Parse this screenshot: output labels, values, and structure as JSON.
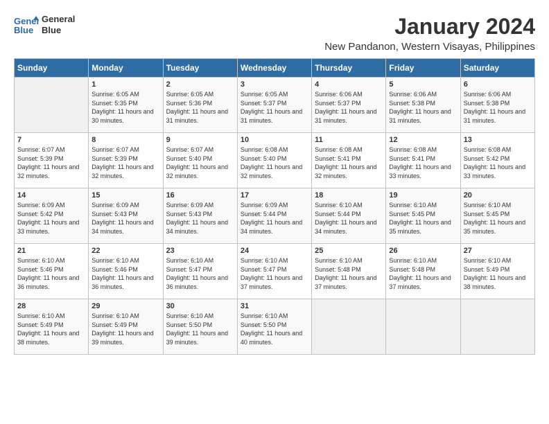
{
  "header": {
    "logo_line1": "General",
    "logo_line2": "Blue",
    "title": "January 2024",
    "subtitle": "New Pandanon, Western Visayas, Philippines"
  },
  "weekdays": [
    "Sunday",
    "Monday",
    "Tuesday",
    "Wednesday",
    "Thursday",
    "Friday",
    "Saturday"
  ],
  "weeks": [
    [
      {
        "day": "",
        "sunrise": "",
        "sunset": "",
        "daylight": ""
      },
      {
        "day": "1",
        "sunrise": "Sunrise: 6:05 AM",
        "sunset": "Sunset: 5:35 PM",
        "daylight": "Daylight: 11 hours and 30 minutes."
      },
      {
        "day": "2",
        "sunrise": "Sunrise: 6:05 AM",
        "sunset": "Sunset: 5:36 PM",
        "daylight": "Daylight: 11 hours and 31 minutes."
      },
      {
        "day": "3",
        "sunrise": "Sunrise: 6:05 AM",
        "sunset": "Sunset: 5:37 PM",
        "daylight": "Daylight: 11 hours and 31 minutes."
      },
      {
        "day": "4",
        "sunrise": "Sunrise: 6:06 AM",
        "sunset": "Sunset: 5:37 PM",
        "daylight": "Daylight: 11 hours and 31 minutes."
      },
      {
        "day": "5",
        "sunrise": "Sunrise: 6:06 AM",
        "sunset": "Sunset: 5:38 PM",
        "daylight": "Daylight: 11 hours and 31 minutes."
      },
      {
        "day": "6",
        "sunrise": "Sunrise: 6:06 AM",
        "sunset": "Sunset: 5:38 PM",
        "daylight": "Daylight: 11 hours and 31 minutes."
      }
    ],
    [
      {
        "day": "7",
        "sunrise": "Sunrise: 6:07 AM",
        "sunset": "Sunset: 5:39 PM",
        "daylight": "Daylight: 11 hours and 32 minutes."
      },
      {
        "day": "8",
        "sunrise": "Sunrise: 6:07 AM",
        "sunset": "Sunset: 5:39 PM",
        "daylight": "Daylight: 11 hours and 32 minutes."
      },
      {
        "day": "9",
        "sunrise": "Sunrise: 6:07 AM",
        "sunset": "Sunset: 5:40 PM",
        "daylight": "Daylight: 11 hours and 32 minutes."
      },
      {
        "day": "10",
        "sunrise": "Sunrise: 6:08 AM",
        "sunset": "Sunset: 5:40 PM",
        "daylight": "Daylight: 11 hours and 32 minutes."
      },
      {
        "day": "11",
        "sunrise": "Sunrise: 6:08 AM",
        "sunset": "Sunset: 5:41 PM",
        "daylight": "Daylight: 11 hours and 32 minutes."
      },
      {
        "day": "12",
        "sunrise": "Sunrise: 6:08 AM",
        "sunset": "Sunset: 5:41 PM",
        "daylight": "Daylight: 11 hours and 33 minutes."
      },
      {
        "day": "13",
        "sunrise": "Sunrise: 6:08 AM",
        "sunset": "Sunset: 5:42 PM",
        "daylight": "Daylight: 11 hours and 33 minutes."
      }
    ],
    [
      {
        "day": "14",
        "sunrise": "Sunrise: 6:09 AM",
        "sunset": "Sunset: 5:42 PM",
        "daylight": "Daylight: 11 hours and 33 minutes."
      },
      {
        "day": "15",
        "sunrise": "Sunrise: 6:09 AM",
        "sunset": "Sunset: 5:43 PM",
        "daylight": "Daylight: 11 hours and 34 minutes."
      },
      {
        "day": "16",
        "sunrise": "Sunrise: 6:09 AM",
        "sunset": "Sunset: 5:43 PM",
        "daylight": "Daylight: 11 hours and 34 minutes."
      },
      {
        "day": "17",
        "sunrise": "Sunrise: 6:09 AM",
        "sunset": "Sunset: 5:44 PM",
        "daylight": "Daylight: 11 hours and 34 minutes."
      },
      {
        "day": "18",
        "sunrise": "Sunrise: 6:10 AM",
        "sunset": "Sunset: 5:44 PM",
        "daylight": "Daylight: 11 hours and 34 minutes."
      },
      {
        "day": "19",
        "sunrise": "Sunrise: 6:10 AM",
        "sunset": "Sunset: 5:45 PM",
        "daylight": "Daylight: 11 hours and 35 minutes."
      },
      {
        "day": "20",
        "sunrise": "Sunrise: 6:10 AM",
        "sunset": "Sunset: 5:45 PM",
        "daylight": "Daylight: 11 hours and 35 minutes."
      }
    ],
    [
      {
        "day": "21",
        "sunrise": "Sunrise: 6:10 AM",
        "sunset": "Sunset: 5:46 PM",
        "daylight": "Daylight: 11 hours and 36 minutes."
      },
      {
        "day": "22",
        "sunrise": "Sunrise: 6:10 AM",
        "sunset": "Sunset: 5:46 PM",
        "daylight": "Daylight: 11 hours and 36 minutes."
      },
      {
        "day": "23",
        "sunrise": "Sunrise: 6:10 AM",
        "sunset": "Sunset: 5:47 PM",
        "daylight": "Daylight: 11 hours and 36 minutes."
      },
      {
        "day": "24",
        "sunrise": "Sunrise: 6:10 AM",
        "sunset": "Sunset: 5:47 PM",
        "daylight": "Daylight: 11 hours and 37 minutes."
      },
      {
        "day": "25",
        "sunrise": "Sunrise: 6:10 AM",
        "sunset": "Sunset: 5:48 PM",
        "daylight": "Daylight: 11 hours and 37 minutes."
      },
      {
        "day": "26",
        "sunrise": "Sunrise: 6:10 AM",
        "sunset": "Sunset: 5:48 PM",
        "daylight": "Daylight: 11 hours and 37 minutes."
      },
      {
        "day": "27",
        "sunrise": "Sunrise: 6:10 AM",
        "sunset": "Sunset: 5:49 PM",
        "daylight": "Daylight: 11 hours and 38 minutes."
      }
    ],
    [
      {
        "day": "28",
        "sunrise": "Sunrise: 6:10 AM",
        "sunset": "Sunset: 5:49 PM",
        "daylight": "Daylight: 11 hours and 38 minutes."
      },
      {
        "day": "29",
        "sunrise": "Sunrise: 6:10 AM",
        "sunset": "Sunset: 5:49 PM",
        "daylight": "Daylight: 11 hours and 39 minutes."
      },
      {
        "day": "30",
        "sunrise": "Sunrise: 6:10 AM",
        "sunset": "Sunset: 5:50 PM",
        "daylight": "Daylight: 11 hours and 39 minutes."
      },
      {
        "day": "31",
        "sunrise": "Sunrise: 6:10 AM",
        "sunset": "Sunset: 5:50 PM",
        "daylight": "Daylight: 11 hours and 40 minutes."
      },
      {
        "day": "",
        "sunrise": "",
        "sunset": "",
        "daylight": ""
      },
      {
        "day": "",
        "sunrise": "",
        "sunset": "",
        "daylight": ""
      },
      {
        "day": "",
        "sunrise": "",
        "sunset": "",
        "daylight": ""
      }
    ]
  ]
}
